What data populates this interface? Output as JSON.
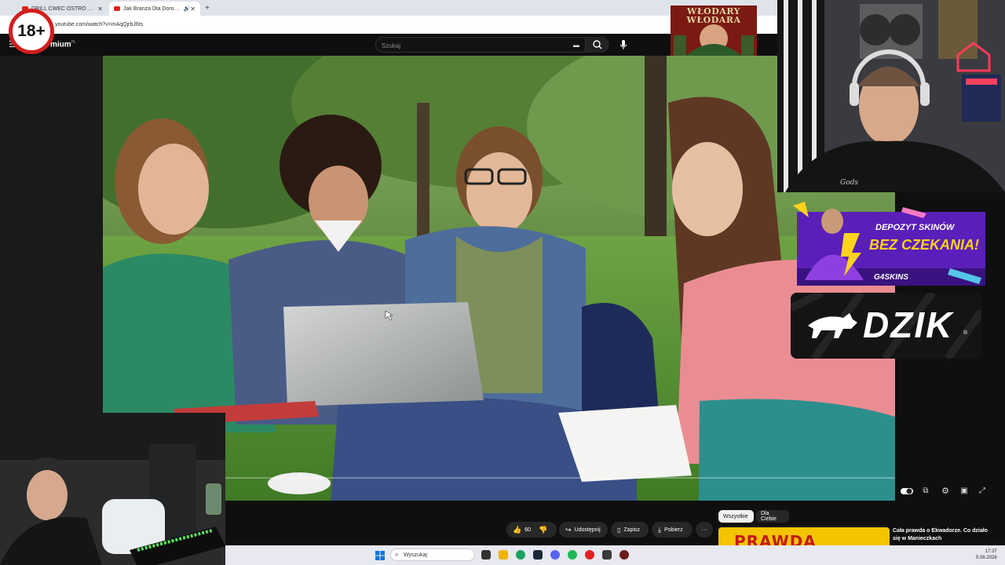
{
  "browser": {
    "tabs": [
      {
        "label": "DRILL CWEC OSTRO O LUDZIACH",
        "close": "✕"
      },
      {
        "label": "Jak Branża Dla Dorosłych Szkodzi",
        "close": "✕"
      }
    ],
    "new_tab": "+",
    "url": "youtube.com/watch?v=mAqQjrbJ6ts"
  },
  "youtube": {
    "logo_suffix": "mium",
    "logo_region": "PL",
    "search_placeholder": "Szukaj",
    "actions": {
      "likes": "60",
      "share": "Udostępnij",
      "save": "Zapisz",
      "download": "Pobierz",
      "more": "···"
    },
    "chips": [
      "Wszystkie",
      "Dla Ciebie"
    ],
    "recommendation": {
      "thumb_text": "PRAWDA",
      "title": "Cała prawda o Ekwadorze. Co działo się w Manieczkach"
    }
  },
  "overlay": {
    "age_rating": "18+",
    "wlodary_text": "WŁODARY WŁODARA",
    "g4skins_line1": "DEPOZYT SKINÓW",
    "g4skins_line2": "BEZ CZEKANIA!",
    "g4skins_brand": "G4SKINS",
    "dzik_brand": "DZIK",
    "dzik_reg": "®",
    "shirt_text": "Gods"
  },
  "taskbar": {
    "search_placeholder": "Wyszukaj",
    "time": "17:37",
    "date": "5.08.2026"
  },
  "colors": {
    "youtube_red": "#e62117",
    "g4_purple": "#6a2bd6",
    "g4_yellow": "#ffd21e"
  }
}
